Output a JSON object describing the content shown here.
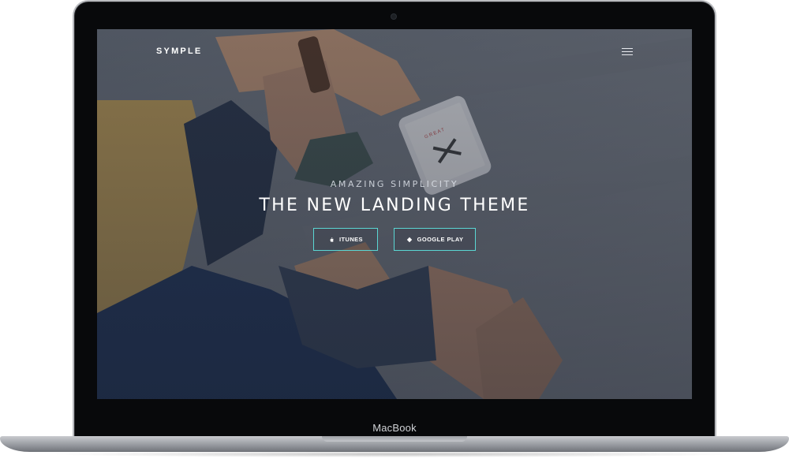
{
  "device": {
    "label": "MacBook"
  },
  "site": {
    "brand": "SYMPLE",
    "menu_icon": "hamburger-menu-icon"
  },
  "hero": {
    "eyebrow": "AMAZING SIMPLICITY",
    "title": "THE NEW LANDING THEME"
  },
  "buttons": [
    {
      "label": "ITUNES",
      "icon": "apple-icon"
    },
    {
      "label": "GOOGLE PLAY",
      "icon": "android-play-icon"
    }
  ],
  "colors": {
    "accent": "#5ad7d4",
    "overlay": "#141a28",
    "bezel": "#08090b"
  }
}
